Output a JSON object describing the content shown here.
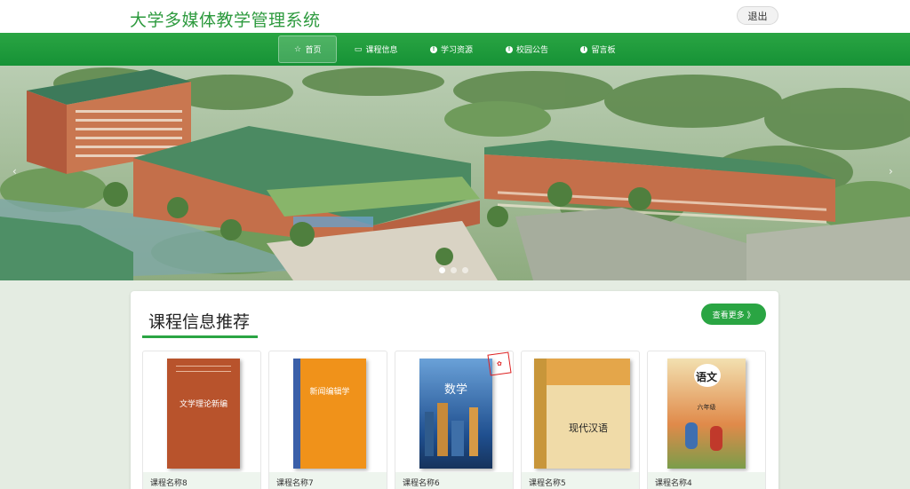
{
  "header": {
    "site_title": "大学多媒体教学管理系统",
    "logout_label": "退出"
  },
  "nav": {
    "items": [
      {
        "label": "首页",
        "icon": "star-icon"
      },
      {
        "label": "课程信息",
        "icon": "document-icon"
      },
      {
        "label": "学习资源",
        "icon": "info-circle-icon"
      },
      {
        "label": "校园公告",
        "icon": "info-circle-icon"
      },
      {
        "label": "留言板",
        "icon": "info-circle-icon"
      }
    ]
  },
  "banner": {
    "slide_count": 3,
    "active_slide": 1,
    "prev_icon": "chevron-left-icon",
    "next_icon": "chevron-right-icon"
  },
  "recommend": {
    "title": "课程信息推荐",
    "more_label": "查看更多 》",
    "courses": [
      {
        "name": "课程名称8",
        "cover_title": "文学理论新编"
      },
      {
        "name": "课程名称7",
        "cover_title": "新闻编辑学"
      },
      {
        "name": "课程名称6",
        "cover_title": "数学"
      },
      {
        "name": "课程名称5",
        "cover_title": "现代汉语"
      },
      {
        "name": "课程名称4",
        "cover_title": "语文",
        "cover_subtitle": "六年级"
      }
    ]
  },
  "colors": {
    "brand_green": "#2aa543",
    "title_green": "#2d9a3e"
  }
}
